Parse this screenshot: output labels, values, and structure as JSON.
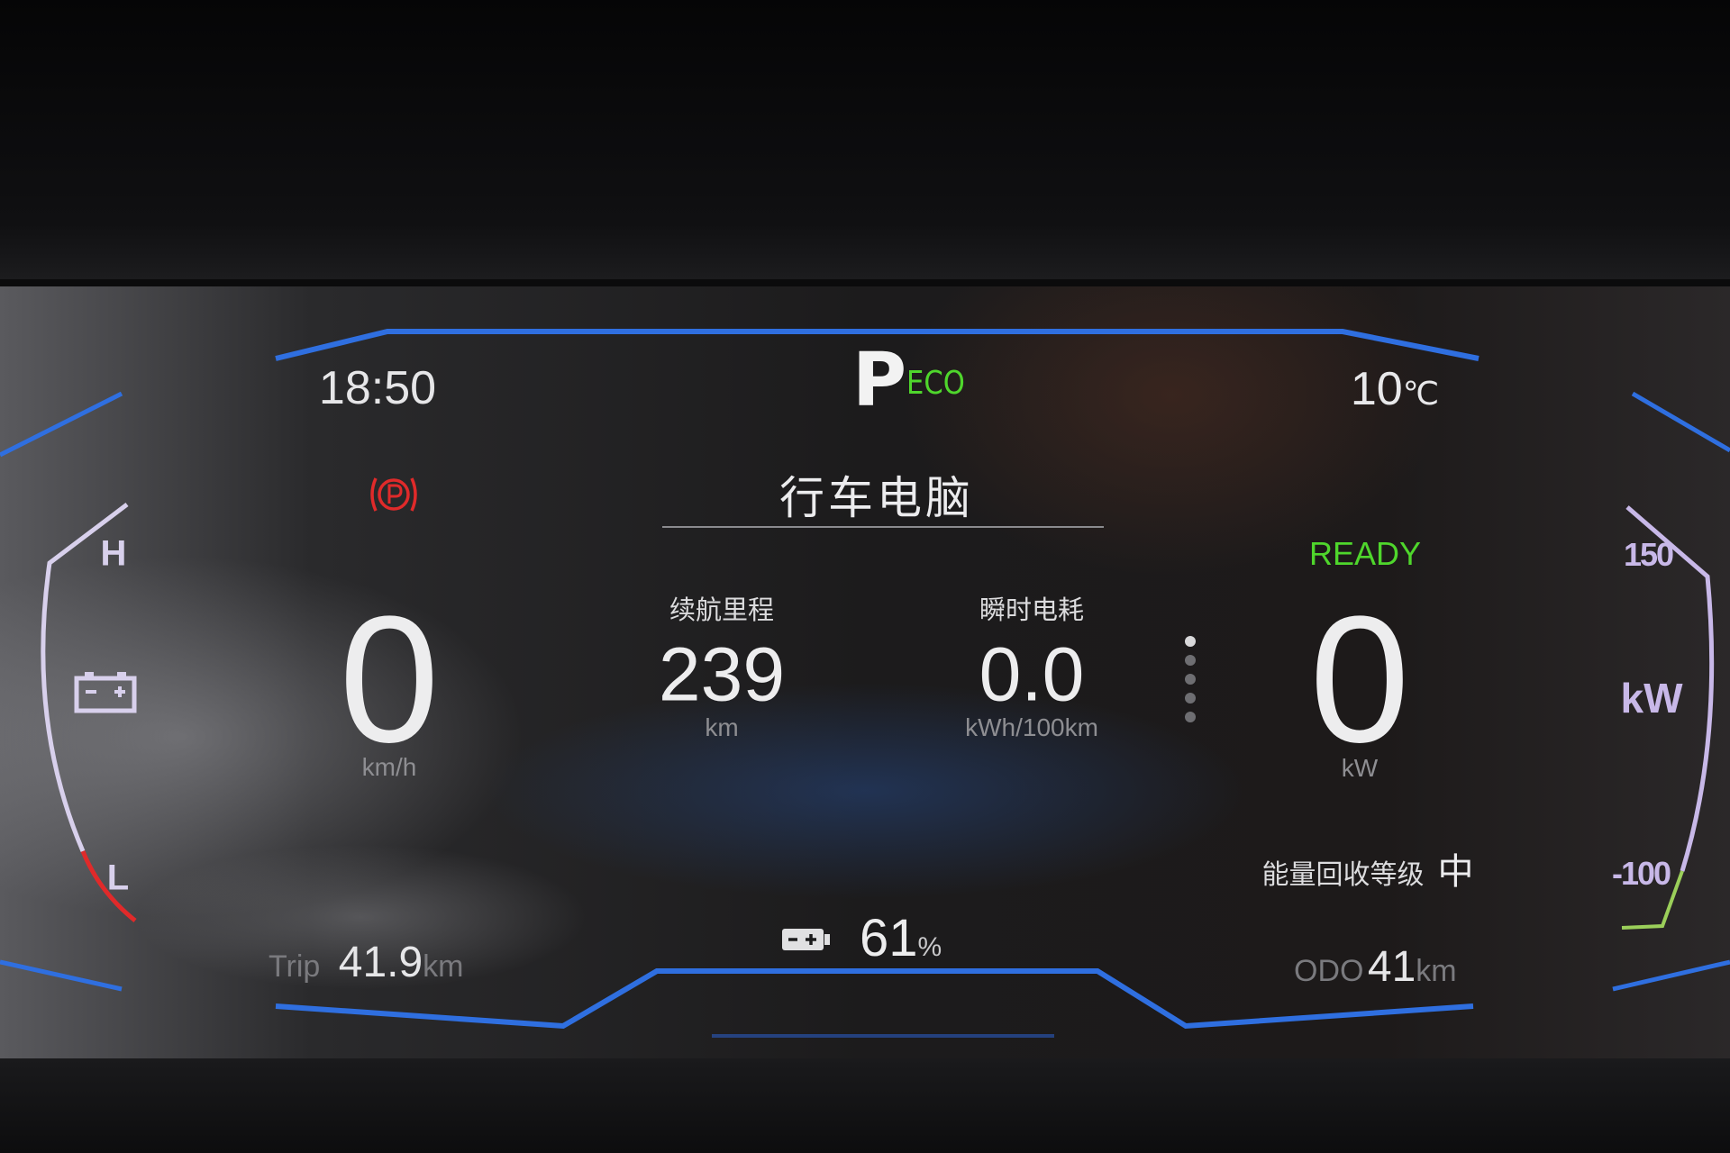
{
  "status_bar": {
    "time": "18:50",
    "gear": "P",
    "drive_mode": "ECO",
    "temperature": "10",
    "temperature_unit": "℃"
  },
  "indicators": {
    "parking_brake_icon": "parking-brake-icon",
    "ready": "READY"
  },
  "colors": {
    "accent_blue": "#2f6fe0",
    "ready_green": "#4fd62c",
    "eco_green": "#4fd62c",
    "warning_red": "#e02a2a",
    "gauge_purple": "#c8b8e8"
  },
  "left_gauge": {
    "top_label": "H",
    "bottom_label": "L",
    "icon": "battery-icon"
  },
  "speed": {
    "value": "0",
    "unit": "km/h"
  },
  "trip_computer": {
    "title": "行车电脑",
    "range": {
      "label": "续航里程",
      "value": "239",
      "unit": "km"
    },
    "consumption": {
      "label": "瞬时电耗",
      "value": "0.0",
      "unit": "kWh/100km"
    }
  },
  "power": {
    "value": "0",
    "unit": "kW"
  },
  "right_gauge": {
    "max_label": "150",
    "unit": "kW",
    "min_label": "-100"
  },
  "regen": {
    "label": "能量回收等级",
    "level": "中"
  },
  "trip": {
    "label": "Trip",
    "value": "41.9",
    "unit": "km"
  },
  "battery": {
    "icon": "battery-icon",
    "value": "61",
    "unit": "%"
  },
  "odo": {
    "label": "ODO",
    "value": "41",
    "unit": "km"
  }
}
